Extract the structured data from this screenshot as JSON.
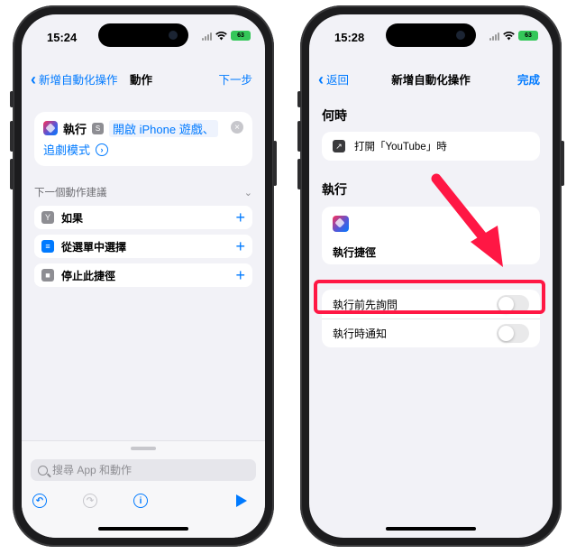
{
  "left_screen": {
    "status": {
      "time": "15:24",
      "battery": "63"
    },
    "nav": {
      "back_label": "新增自動化操作",
      "title": "動作",
      "next_label": "下一步"
    },
    "action": {
      "run_label": "執行",
      "param_line1": "開啟 iPhone 遊戲、",
      "param_line2": "追劇模式"
    },
    "suggestions": {
      "header": "下一個動作建議",
      "items": [
        {
          "label": "如果",
          "icon": "branch-icon"
        },
        {
          "label": "從選單中選擇",
          "icon": "menu-icon"
        },
        {
          "label": "停止此捷徑",
          "icon": "stop-icon"
        }
      ]
    },
    "search": {
      "placeholder": "搜尋 App 和動作"
    }
  },
  "right_screen": {
    "status": {
      "time": "15:28",
      "battery": "63"
    },
    "nav": {
      "back_label": "返回",
      "title": "新增自動化操作",
      "done_label": "完成"
    },
    "when_header": "何時",
    "trigger_text": "打開「YouTube」時",
    "run_header": "執行",
    "shortcut_name": "執行捷徑",
    "toggles": [
      {
        "label": "執行前先詢問",
        "on": false
      },
      {
        "label": "執行時通知",
        "on": false
      }
    ]
  },
  "colors": {
    "accent": "#007aff",
    "highlight": "#ff1744",
    "background": "#f2f2f7"
  }
}
